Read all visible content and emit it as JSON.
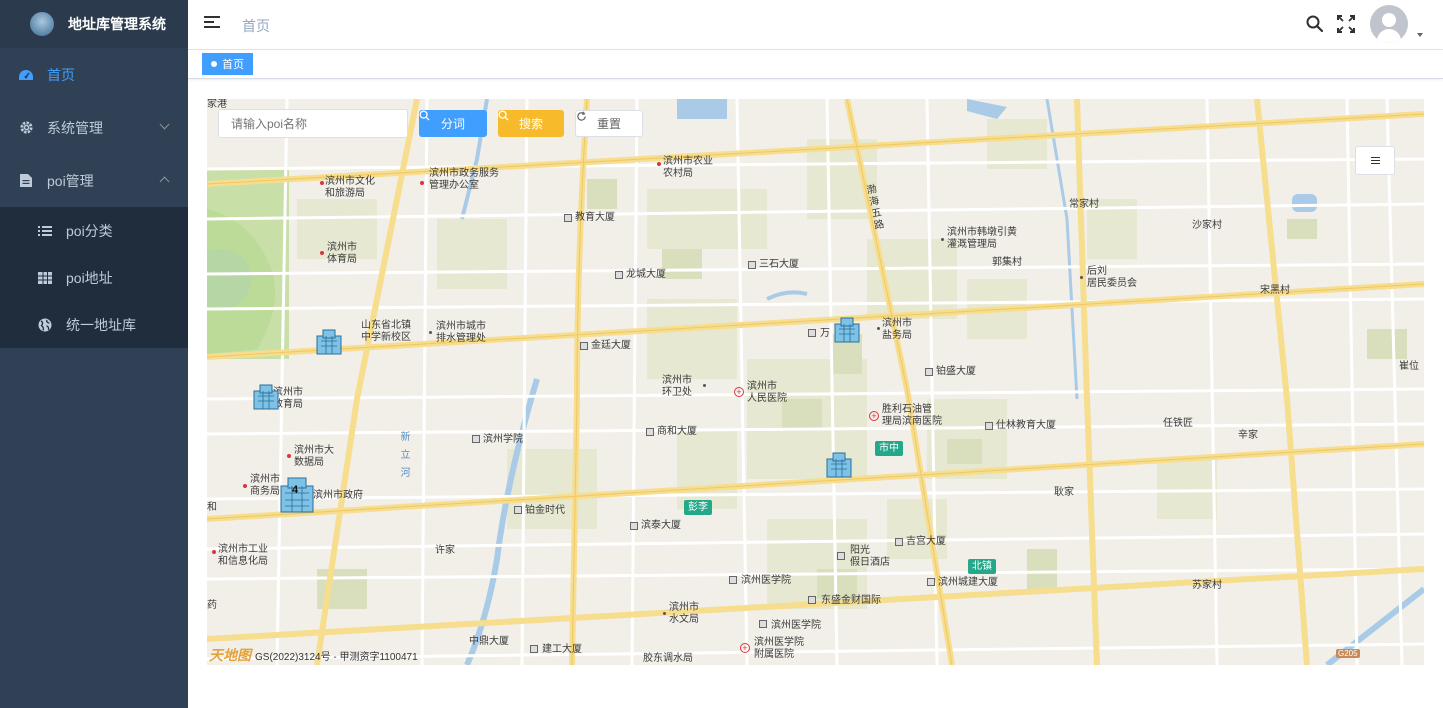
{
  "sidebar": {
    "app_title": "地址库管理系统",
    "items": [
      {
        "label": "首页",
        "icon": "dashboard-icon",
        "active": true
      },
      {
        "label": "系统管理",
        "icon": "gear-icon"
      },
      {
        "label": "poi管理",
        "icon": "document-icon"
      }
    ],
    "sub_items": [
      {
        "label": "poi分类",
        "icon": "list-icon"
      },
      {
        "label": "poi地址",
        "icon": "table-icon"
      },
      {
        "label": "统一地址库",
        "icon": "globe-icon"
      }
    ]
  },
  "header": {
    "breadcrumb": "首页",
    "icons": [
      "hamburger-icon",
      "search-icon",
      "fullscreen-icon",
      "avatar-icon"
    ]
  },
  "tags": {
    "active_tag": "首页"
  },
  "toolbar": {
    "search_placeholder": "请输入poi名称",
    "segment_label": "分词",
    "search_label": "搜索",
    "reset_label": "重置"
  },
  "map": {
    "attribution": "GS(2022)3124号 - 甲测资字1100471",
    "provider_logo": "天地图",
    "road_shield": "G205",
    "labels": [
      "滨州市文化\n和旅游局",
      "滨州市政务服务\n管理办公室",
      "滨州市农业\n农村局",
      "滨州市\n体育局",
      "教育大厦",
      "滨州市韩墩引黄\n灌溉管理局",
      "常家村",
      "沙家村",
      "郭集村",
      "后刘\n居民委员会",
      "龙城大厦",
      "三石大厦",
      "宋黑村",
      "山东省北镇\n中学新校区",
      "滨州市城市\n排水管理处",
      "滨州市\n盐务局",
      "金廷大厦",
      "滨州市\n环卫处",
      "滨州市\n人民医院",
      "铂盛大厦",
      "崔位",
      "滨州市\n教育局",
      "胜利石油管\n理局滨南医院",
      "仕林教育大厦",
      "任铁匠",
      "辛家",
      "商和大厦",
      "滨州学院",
      "滨州市大\n数据局",
      "滨州市\n商务局",
      "滨州市政府",
      "耿家",
      "铂金时代",
      "渤海五路",
      "新立河",
      "滨泰大厦",
      "吉宫大厦",
      "阳光\n假日酒店",
      "滨州市工业\n和信息化局",
      "许家",
      "滨州医学院",
      "东盛金财国际",
      "滨州城建大厦",
      "苏家村",
      "滨州市\n水文局",
      "滨州医学院",
      "滨州医学院\n附属医院",
      "中鼎大厦",
      "建工大厦",
      "胶东调水局",
      "和",
      "药",
      "家港",
      "万"
    ],
    "road_badges": [
      "市中",
      "彭李",
      "北镇"
    ],
    "cluster_count": "4"
  }
}
